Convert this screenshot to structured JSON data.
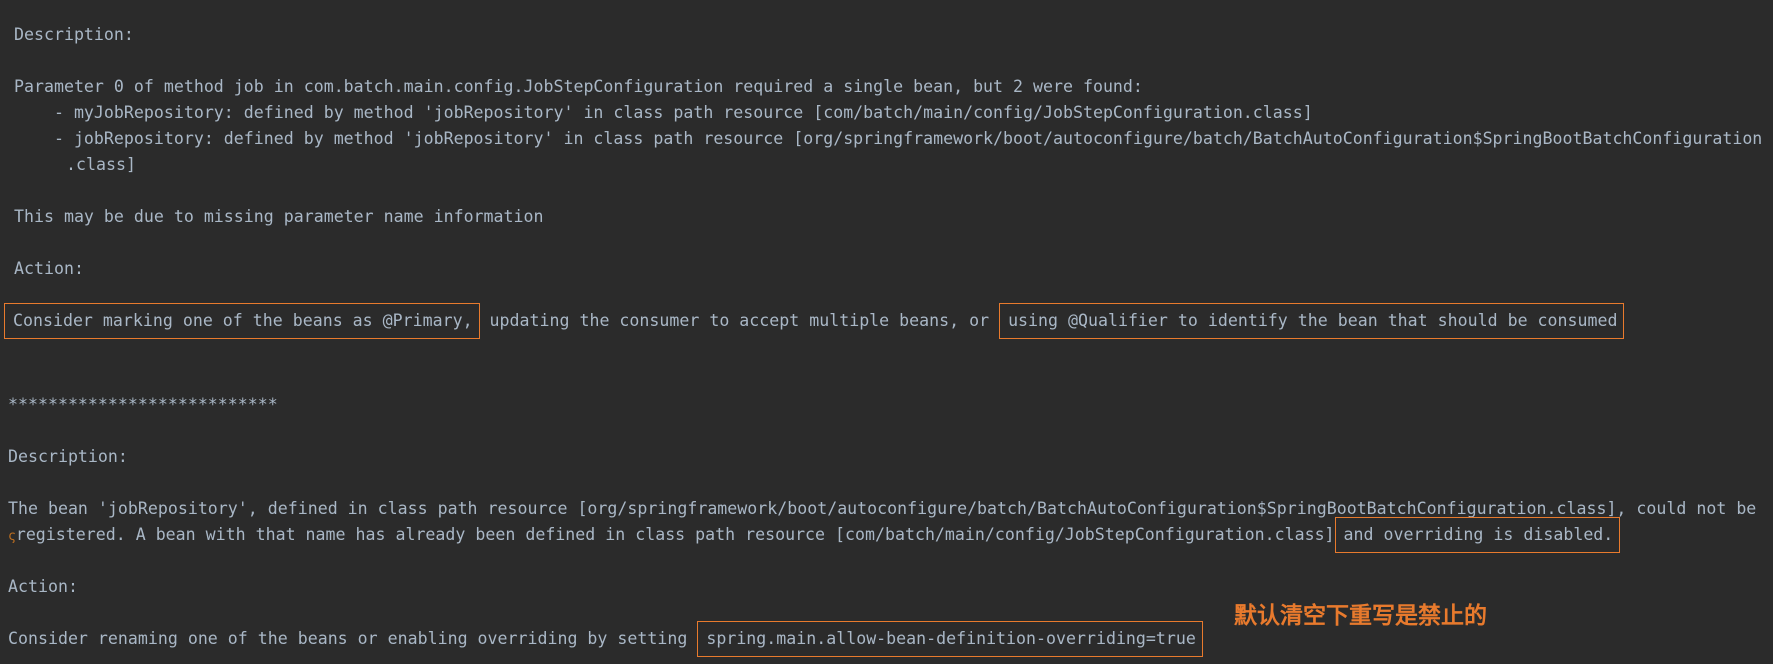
{
  "log": {
    "b1_desc_header": "Description:",
    "b1_desc_text": "Parameter 0 of method job in com.batch.main.config.JobStepConfiguration required a single bean, but 2 were found:",
    "b1_item1": "    - myJobRepository: defined by method 'jobRepository' in class path resource [com/batch/main/config/JobStepConfiguration.class]",
    "b1_item2": "    - jobRepository: defined by method 'jobRepository' in class path resource [org/springframework/boot/autoconfigure/batch/BatchAutoConfiguration$SpringBootBatchConfiguration",
    "b1_item2_cont": ".class]",
    "b1_note": "This may be due to missing parameter name information",
    "b1_action_header": "Action:",
    "b1_action_part1": "Consider marking one of the beans as @Primary,",
    "b1_action_part2": " updating the consumer to accept multiple beans, or ",
    "b1_action_part3": "using @Qualifier to identify the bean that should be consumed",
    "separator": "***************************",
    "b2_desc_header": "Description:",
    "b2_desc_line1": "The bean 'jobRepository', defined in class path resource [org/springframework/boot/autoconfigure/batch/BatchAutoConfiguration$SpringBootBatchConfiguration.class], could not be",
    "b2_desc_line2_wrap": "ς",
    "b2_desc_line2": "registered. A bean with that name has already been defined in class path resource [com/batch/main/config/JobStepConfiguration.class]",
    "b2_desc_line2_hl": "and overriding is disabled.",
    "b2_action_header": "Action:",
    "b2_action_text": "Consider renaming one of the beans or enabling overriding by setting ",
    "b2_action_hl": "spring.main.allow-bean-definition-overriding=true"
  },
  "annotation": {
    "text": "默认清空下重写是禁止的",
    "color": "#e87a2d"
  },
  "colors": {
    "background": "#2b2b2b",
    "text": "#a9b7c6",
    "highlight_box": "#e87a2d"
  }
}
